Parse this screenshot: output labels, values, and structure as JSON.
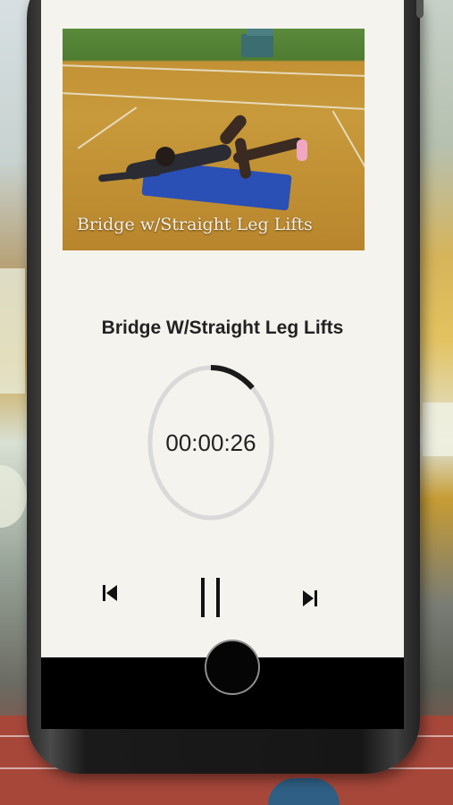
{
  "exercise": {
    "image_caption": "Bridge w/Straight Leg Lifts",
    "title": "Bridge W/Straight Leg Lifts"
  },
  "timer": {
    "display": "00:00:26",
    "progress_fraction": 0.12,
    "track_color": "#d9d9d9",
    "progress_color": "#1a1a1a"
  },
  "controls": {
    "previous_icon": "skip-previous-icon",
    "pause_icon": "pause-icon",
    "next_icon": "skip-next-icon"
  },
  "colors": {
    "screen_background": "#f5f3ee",
    "title_text": "#222222"
  }
}
